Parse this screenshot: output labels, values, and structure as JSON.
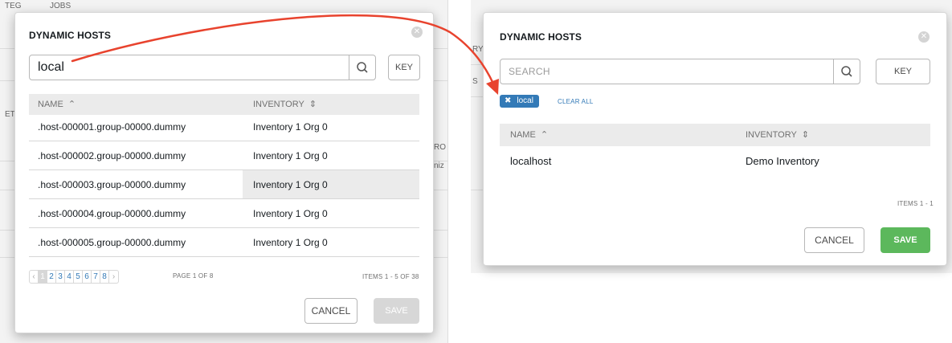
{
  "background": {
    "left_fragments": [
      "TEG",
      "JOBS",
      "ET",
      "RO",
      "niz"
    ],
    "right_fragments": [
      "RY",
      "S"
    ]
  },
  "left_modal": {
    "title": "DYNAMIC HOSTS",
    "search_value": "local",
    "key_label": "KEY",
    "columns": {
      "name": "NAME",
      "name_sort": "⌃",
      "inventory": "INVENTORY",
      "inventory_sort": "⇕"
    },
    "rows": [
      {
        "name": ".host-000001.group-00000.dummy",
        "inventory": "Inventory 1 Org 0"
      },
      {
        "name": ".host-000002.group-00000.dummy",
        "inventory": "Inventory 1 Org 0"
      },
      {
        "name": ".host-000003.group-00000.dummy",
        "inventory": "Inventory 1 Org 0"
      },
      {
        "name": ".host-000004.group-00000.dummy",
        "inventory": "Inventory 1 Org 0"
      },
      {
        "name": ".host-000005.group-00000.dummy",
        "inventory": "Inventory 1 Org 0"
      }
    ],
    "pagination": {
      "prev": "‹",
      "pages": [
        "1",
        "2",
        "3",
        "4",
        "5",
        "6",
        "7",
        "8"
      ],
      "next": "›",
      "page_label": "PAGE 1 OF 8",
      "current_page": 1
    },
    "items_label": "ITEMS 1 - 5 OF 38",
    "cancel_label": "CANCEL",
    "save_label": "SAVE"
  },
  "right_modal": {
    "title": "DYNAMIC HOSTS",
    "search_placeholder": "SEARCH",
    "key_label": "KEY",
    "active_filter": {
      "remove": "✖",
      "label": "local"
    },
    "clear_all_label": "CLEAR ALL",
    "columns": {
      "name": "NAME",
      "name_sort": "⌃",
      "inventory": "INVENTORY",
      "inventory_sort": "⇕"
    },
    "rows": [
      {
        "name": "localhost",
        "inventory": "Demo Inventory"
      }
    ],
    "items_label": "ITEMS  1 - 1",
    "cancel_label": "CANCEL",
    "save_label": "SAVE"
  },
  "icons": {
    "close": "✕"
  },
  "colors": {
    "accent_blue": "#337ab7",
    "save_green": "#5cb85c",
    "arrow_red": "#e8432e",
    "disabled_grey": "#d7d7d7"
  }
}
